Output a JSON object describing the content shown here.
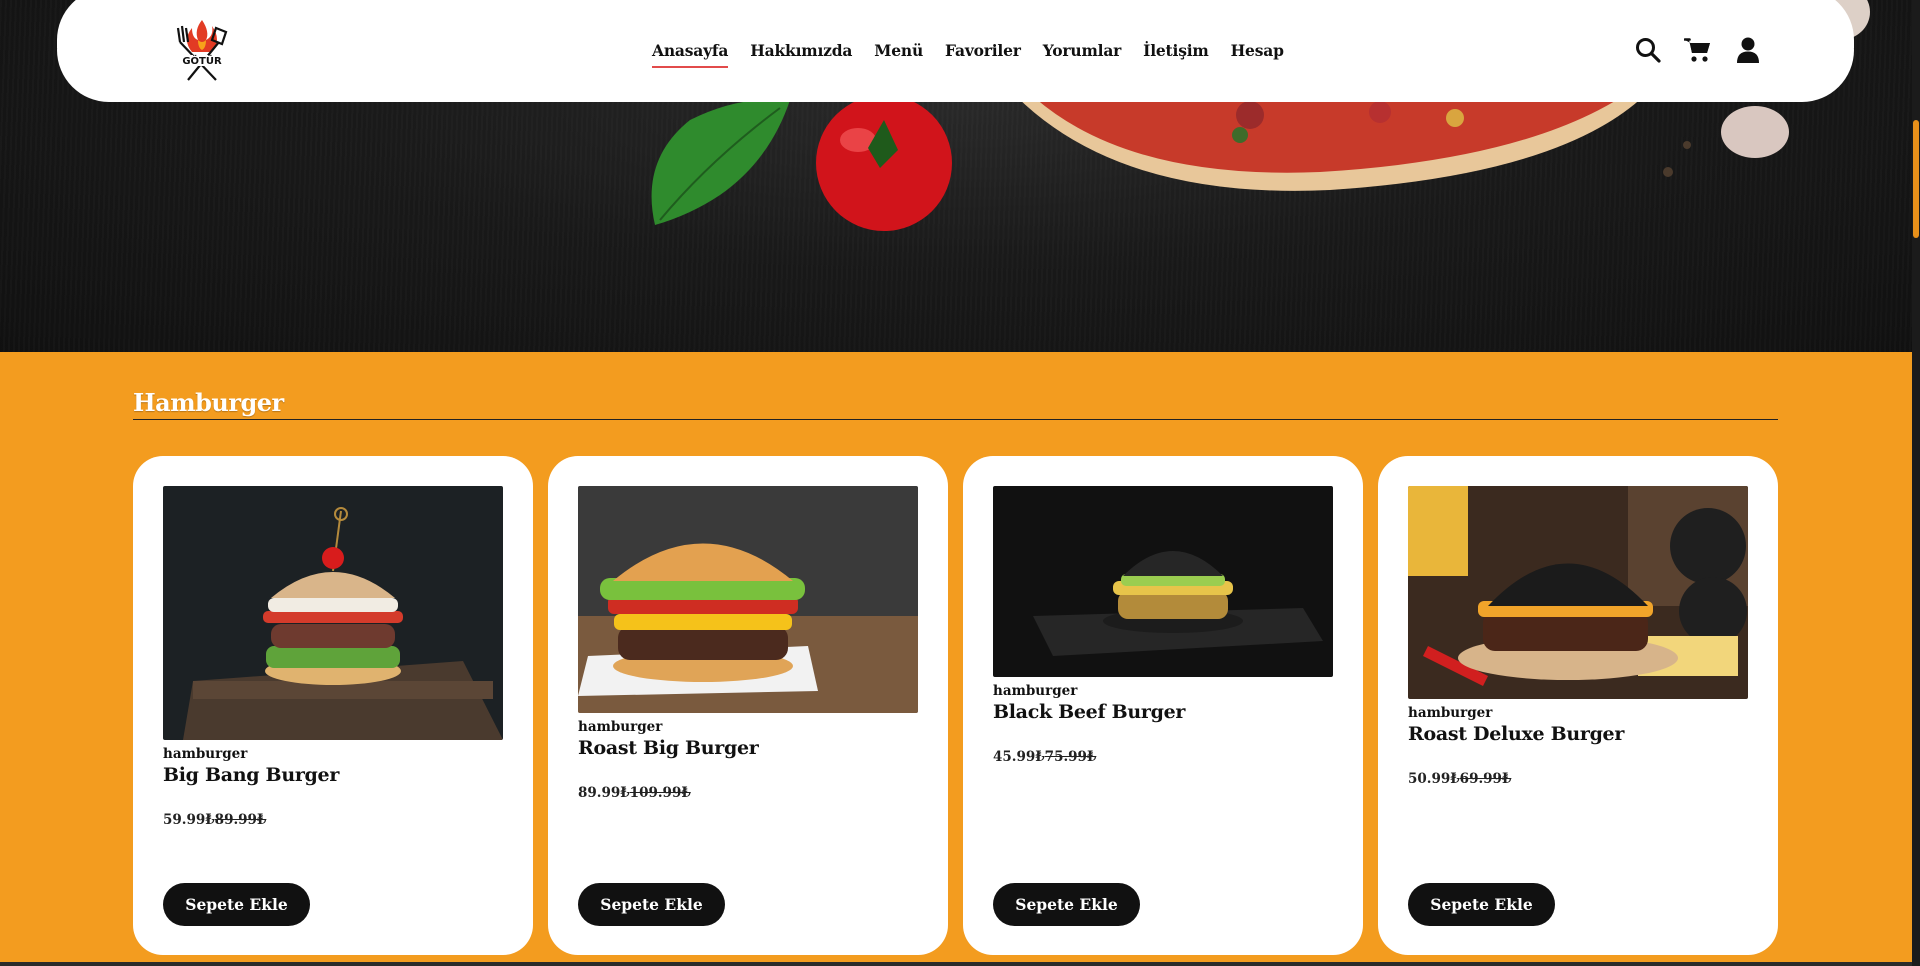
{
  "nav": {
    "logo_text": "GÖTÜR",
    "links": [
      "Anasayfa",
      "Hakkımızda",
      "Menü",
      "Favoriler",
      "Yorumlar",
      "İletişim",
      "Hesap"
    ],
    "active_link": "Anasayfa",
    "icons": [
      "search-icon",
      "cart-icon",
      "user-icon"
    ]
  },
  "section": {
    "title": "Hamburger"
  },
  "products": [
    {
      "category": "hamburger",
      "name": "Big Bang Burger",
      "price": "59.99₺",
      "old_price": "89.99₺",
      "button": "Sepete Ekle"
    },
    {
      "category": "hamburger",
      "name": "Roast Big Burger",
      "price": "89.99₺",
      "old_price": "109.99₺",
      "button": "Sepete Ekle"
    },
    {
      "category": "hamburger",
      "name": "Black Beef Burger",
      "price": "45.99₺",
      "old_price": "75.99₺",
      "button": "Sepete Ekle"
    },
    {
      "category": "hamburger",
      "name": "Roast Deluxe Burger",
      "price": "50.99₺",
      "old_price": "69.99₺",
      "button": "Sepete Ekle"
    }
  ],
  "colors": {
    "section_bg": "#f39c1f",
    "button_bg": "#111111",
    "active_underline": "#e24b4b"
  }
}
